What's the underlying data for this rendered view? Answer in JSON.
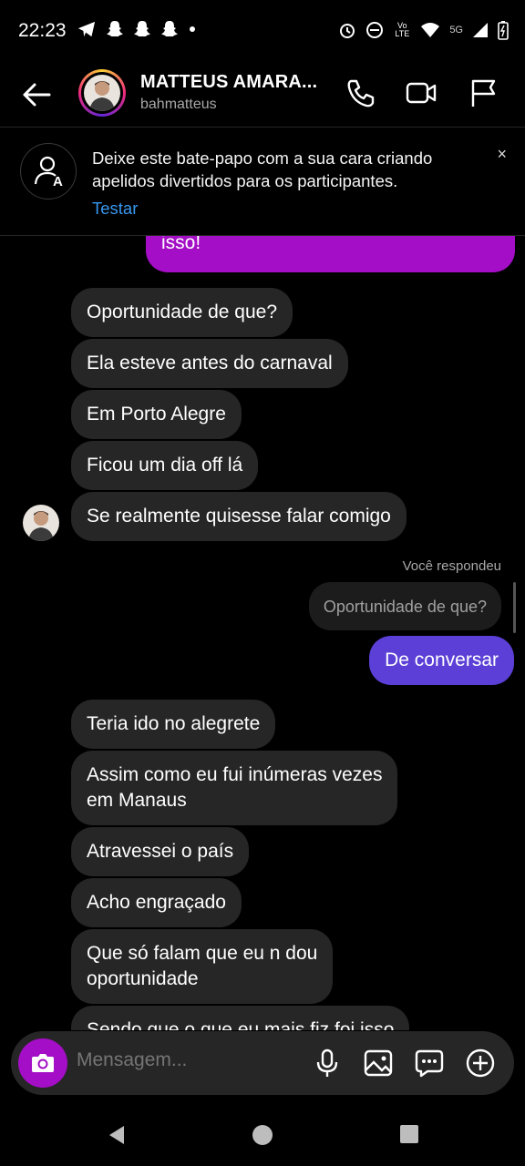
{
  "status_bar": {
    "time": "22:23",
    "left_icons": [
      "telegram-icon",
      "snapchat-icon",
      "snapchat-icon",
      "snapchat-icon",
      "dot-icon"
    ],
    "right_icons": [
      "alarm-icon",
      "dnd-icon",
      "volte-icon",
      "wifi-icon",
      "signal-icon",
      "battery-icon"
    ],
    "network_label": "5G",
    "volte_label": "Vo LTE"
  },
  "header": {
    "name": "MATTEUS AMARA...",
    "username": "bahmatteus",
    "actions": [
      "phone-icon",
      "video-icon",
      "flag-icon"
    ]
  },
  "banner": {
    "text": "Deixe este bate-papo com a sua cara criando apelidos divertidos para os participantes.",
    "link": "Testar",
    "close": "×"
  },
  "messages": {
    "top_sent": "isso!",
    "group1": [
      "Oportunidade de que?",
      "Ela esteve antes do carnaval",
      "Em Porto Alegre",
      "Ficou um dia off lá",
      "Se realmente quisesse falar comigo"
    ],
    "reply_label": "Você respondeu",
    "reply_quote": "Oportunidade de que?",
    "sent_reply": "De conversar",
    "group2": [
      "Teria ido no alegrete",
      "Assim como eu fui inúmeras vezes em Manaus",
      "Atravessei o país",
      "Acho engraçado",
      "Que só falam que eu n dou oportunidade",
      "Sendo que o que eu mais fiz foi isso"
    ],
    "group2_line_breaks": {
      "assim_line1": "Assim como eu fui inúmeras vezes",
      "assim_line2": "em Manaus",
      "que_line1": "Que só falam que eu n dou",
      "que_line2": "oportunidade"
    }
  },
  "composer": {
    "placeholder": "Mensagem..."
  },
  "colors": {
    "sent_purple": "#a40ec6",
    "sent_blue": "#5b3fd6",
    "received_bg": "#262626",
    "link_blue": "#3897f0"
  }
}
